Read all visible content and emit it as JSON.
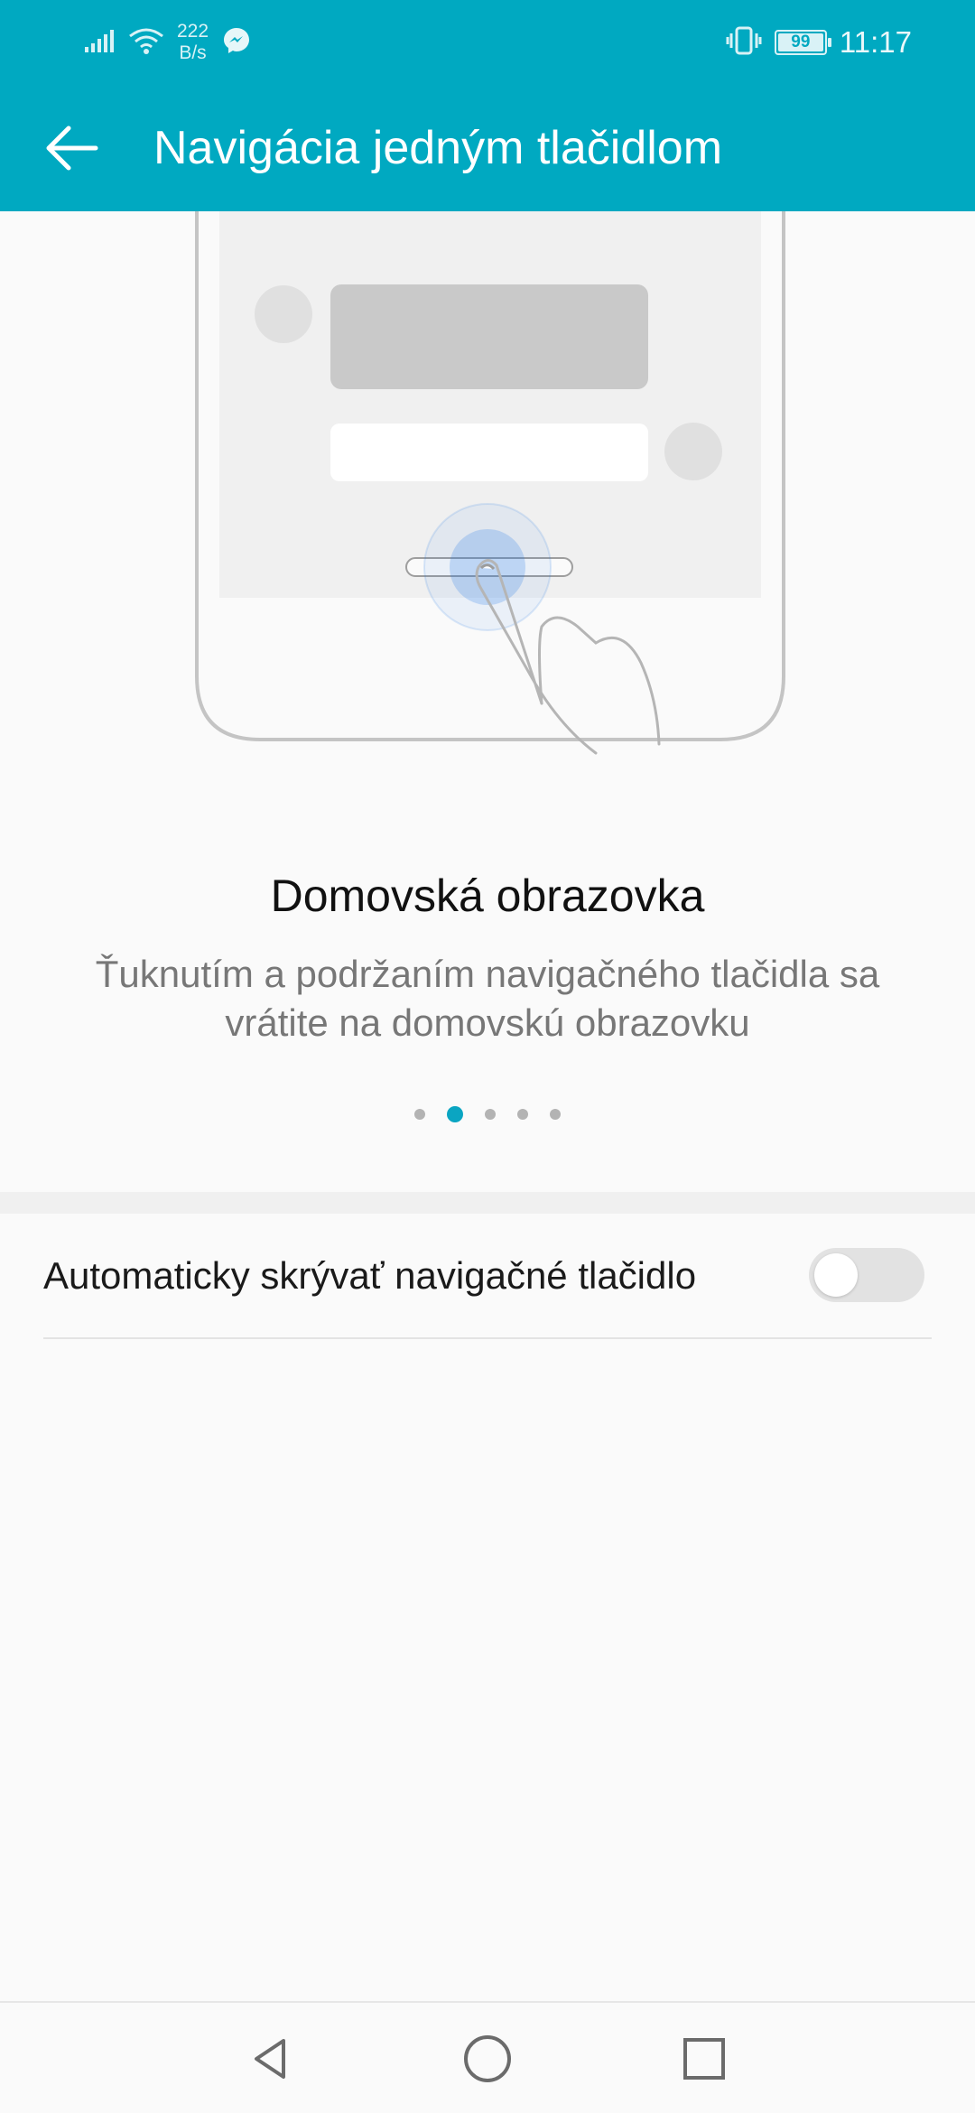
{
  "status_bar": {
    "network_speed_value": "222",
    "network_speed_unit": "B/s",
    "battery_level": "99",
    "time": "11:17",
    "icons": [
      "signal-icon",
      "wifi-icon",
      "messenger-icon",
      "vibrate-icon",
      "battery-icon"
    ]
  },
  "app_bar": {
    "title": "Navigácia jedným tlačidlom",
    "back_icon": "back-arrow-icon"
  },
  "slide": {
    "title": "Domovská obrazovka",
    "description": "Ťuknutím a podržaním navigačného tlačidla sa vrátite na domovskú obrazovku",
    "page_count": 5,
    "active_page": 2
  },
  "settings": {
    "auto_hide_label": "Automaticky skrývať navigačné tlačidlo",
    "auto_hide_enabled": false
  },
  "nav_bar": {
    "icons": [
      "nav-back-icon",
      "nav-home-icon",
      "nav-recents-icon"
    ]
  },
  "colors": {
    "accent": "#00a9c1",
    "background": "#fafafa",
    "active_dot": "#0aa5c2"
  }
}
